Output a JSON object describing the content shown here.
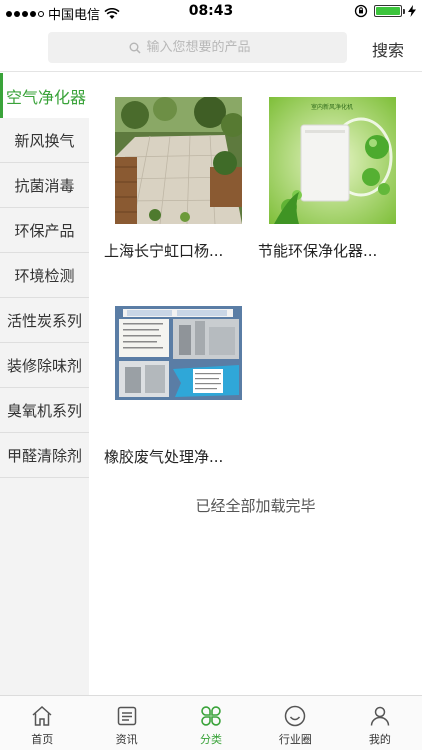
{
  "status_bar": {
    "carrier": "中国电信",
    "time": "08:43"
  },
  "search": {
    "placeholder": "输入您想要的产品",
    "button_label": "搜索"
  },
  "sidebar": {
    "items": [
      {
        "label": "空气净化器",
        "active": true
      },
      {
        "label": "新风换气"
      },
      {
        "label": "抗菌消毒"
      },
      {
        "label": "环保产品"
      },
      {
        "label": "环境检测"
      },
      {
        "label": "活性炭系列"
      },
      {
        "label": "装修除味剂"
      },
      {
        "label": "臭氧机系列"
      },
      {
        "label": "甲醛清除剂"
      }
    ]
  },
  "products": [
    {
      "title": "上海长宁虹口杨..."
    },
    {
      "title": "节能环保净化器...",
      "image_text": "室内新风净化机"
    },
    {
      "title": "橡胶废气处理净..."
    }
  ],
  "end_message": "已经全部加载完毕",
  "tabbar": {
    "tabs": [
      {
        "label": "首页",
        "icon": "home-icon"
      },
      {
        "label": "资讯",
        "icon": "news-icon"
      },
      {
        "label": "分类",
        "icon": "category-icon",
        "active": true
      },
      {
        "label": "行业圈",
        "icon": "circle-icon"
      },
      {
        "label": "我的",
        "icon": "profile-icon"
      }
    ]
  },
  "colors": {
    "accent": "#3aa33a",
    "sidebar_bg": "#f3f3f3"
  }
}
